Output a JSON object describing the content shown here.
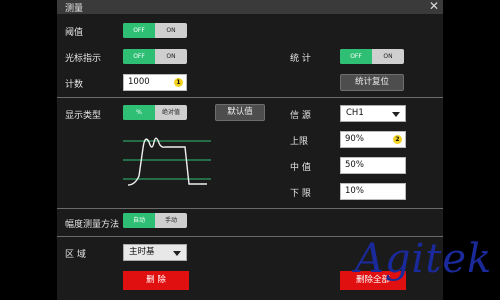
{
  "title": "测量",
  "threshold": {
    "label": "阈值",
    "options": [
      "OFF",
      "ON"
    ],
    "value": "OFF"
  },
  "cursor_indicator": {
    "label": "光标指示",
    "options": [
      "OFF",
      "ON"
    ],
    "value": "OFF"
  },
  "statistics": {
    "label": "统 计",
    "options": [
      "OFF",
      "ON"
    ],
    "value": "OFF"
  },
  "count": {
    "label": "计数",
    "value": "1000",
    "badge": "1"
  },
  "stats_reset": {
    "label": "统计复位"
  },
  "display_type": {
    "label": "显示类型",
    "options": [
      "%",
      "绝对值"
    ],
    "value": "%"
  },
  "default_value": {
    "label": "默认值"
  },
  "source": {
    "label": "信 源",
    "value": "CH1"
  },
  "upper": {
    "label": "上限",
    "value": "90%",
    "badge": "2"
  },
  "middle": {
    "label": "中 值",
    "value": "50%"
  },
  "lower": {
    "label": "下 限",
    "value": "10%"
  },
  "amplitude_method": {
    "label": "幅度测量方法",
    "options": [
      "自动",
      "手动"
    ],
    "value": "自动"
  },
  "region": {
    "label": "区 域",
    "value": "主时基"
  },
  "delete": {
    "label": "删 除"
  },
  "delete_all": {
    "label": "删除全部"
  },
  "watermark": "Agitek",
  "colors": {
    "on": "#2fbf74",
    "danger": "#e01010",
    "badge": "#f2d21e",
    "panel": "#1b1b1b"
  }
}
